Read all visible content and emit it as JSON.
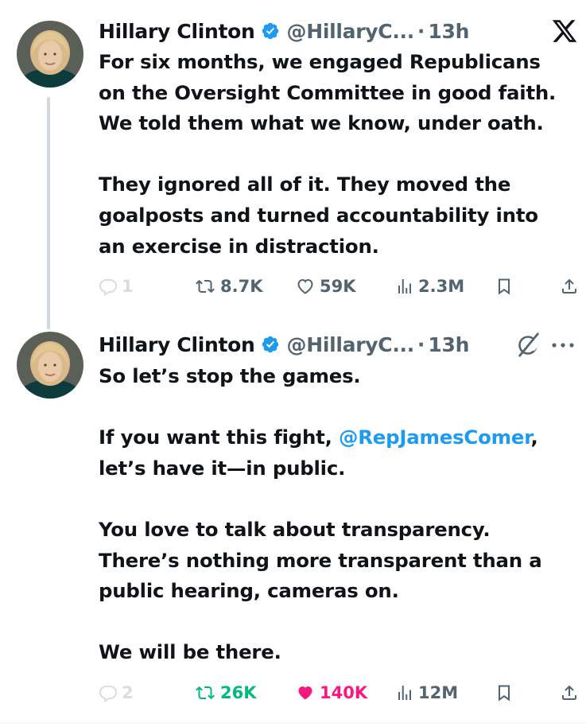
{
  "tweets": [
    {
      "author_name": "Hillary Clinton",
      "handle": "@HillaryC...",
      "separator": "·",
      "time": "13h",
      "body": [
        "For six months, we engaged Republicans",
        "on the Oversight Committee in good faith.",
        "We told them what we know, under oath.",
        "",
        "They ignored all of it. They moved the",
        "goalposts and turned accountability into",
        "an exercise in distraction."
      ],
      "stats": {
        "replies": "1",
        "reposts": "8.7K",
        "likes": "59K",
        "views": "2.3M"
      },
      "liked": false,
      "reposted": false
    },
    {
      "author_name": "Hillary Clinton",
      "handle": "@HillaryC...",
      "separator": "·",
      "time": "13h",
      "body_line1": "So let’s stop the games.",
      "body_line3_prefix": "If you want this fight, ",
      "body_line3_mention": "@RepJamesComer",
      "body_line3_suffix": ",",
      "body_line4": "let’s have it—in public.",
      "body_line6": "You love to talk about transparency.",
      "body_line7": "There’s nothing more transparent than a",
      "body_line8": "public hearing, cameras on.",
      "body_line10": "We will be there.",
      "stats": {
        "replies": "2",
        "reposts": "26K",
        "likes": "140K",
        "views": "12M"
      },
      "liked": true,
      "reposted": true
    }
  ],
  "icons": {
    "platform_logo": "x-logo-icon",
    "verified": "verified-badge-icon",
    "grok": "grok-icon",
    "more": "more-options-icon"
  },
  "colors": {
    "accent": "#1d9bf0",
    "text": "#0f1419",
    "muted": "#536471",
    "repost_active": "#00ba7c",
    "like_active": "#f91880"
  }
}
